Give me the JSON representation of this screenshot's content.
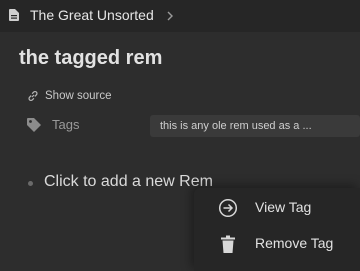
{
  "breadcrumb": {
    "doc_icon": "document-icon",
    "title": "The Great Unsorted",
    "chevron_icon": "chevron-right-icon"
  },
  "page": {
    "title": "the tagged rem"
  },
  "show_source": {
    "icon": "link-icon",
    "label": "Show source"
  },
  "tags": {
    "icon": "tag-icon",
    "label": "Tags",
    "chip_text": "this is any ole rem used as a  ..."
  },
  "editor": {
    "placeholder_text": "Click to add a new Rem"
  },
  "context_menu": {
    "items": [
      {
        "icon": "arrow-circle-right-icon",
        "label": "View Tag"
      },
      {
        "icon": "trash-icon",
        "label": "Remove Tag"
      }
    ]
  },
  "colors": {
    "background": "#2d2d2d",
    "breadcrumb_bar": "#262626",
    "menu_background": "#262626",
    "chip_background": "#3a3a3a"
  }
}
